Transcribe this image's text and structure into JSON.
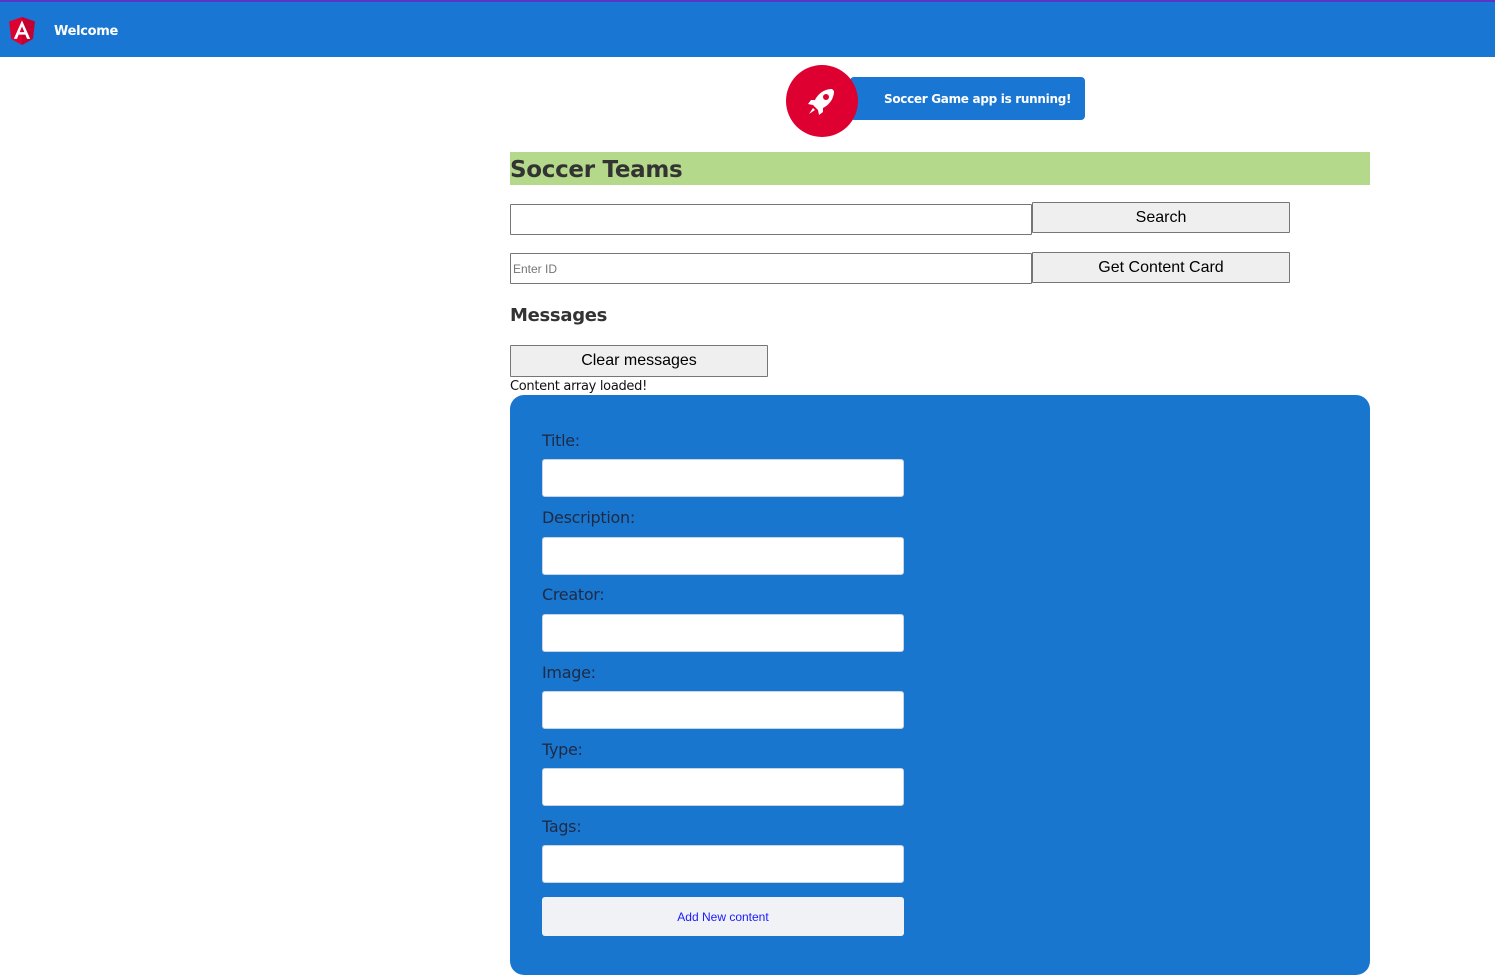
{
  "toolbar": {
    "logo_icon": "angular-logo-icon",
    "title": "Welcome",
    "bg_color": "#1976d2"
  },
  "banner": {
    "icon": "rocket-icon",
    "text": "Soccer Game app is running!"
  },
  "main": {
    "heading": "Soccer Teams",
    "search": {
      "value": "",
      "button": "Search"
    },
    "content_id": {
      "placeholder": "Enter ID",
      "button": "Get Content Card"
    }
  },
  "messages": {
    "heading": "Messages",
    "clear_button": "Clear messages",
    "items": [
      "Content array loaded!"
    ]
  },
  "form": {
    "fields": [
      {
        "label": "Title:",
        "value": ""
      },
      {
        "label": "Description:",
        "value": ""
      },
      {
        "label": "Creator:",
        "value": ""
      },
      {
        "label": "Image:",
        "value": ""
      },
      {
        "label": "Type:",
        "value": ""
      },
      {
        "label": "Tags:",
        "value": ""
      }
    ],
    "submit_button": "Add New content",
    "bg_color": "#1976cf"
  }
}
